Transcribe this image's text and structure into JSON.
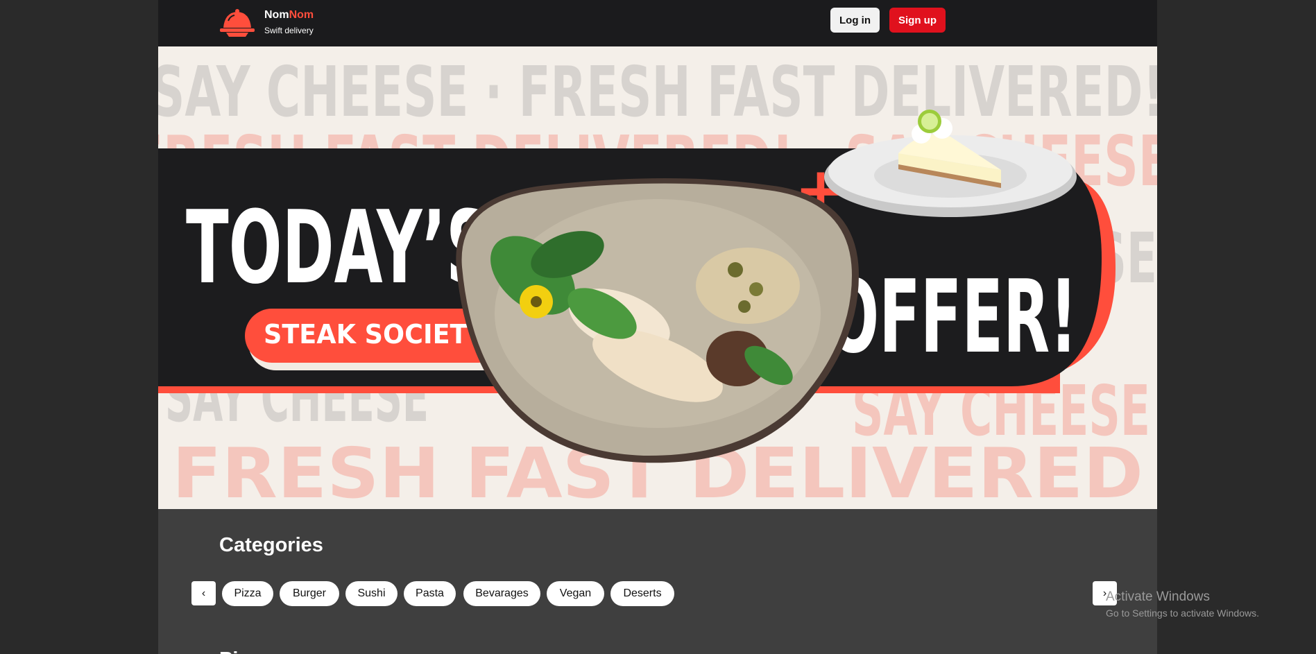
{
  "header": {
    "brand_primary": "Nom",
    "brand_accent": "Nom",
    "tagline": "Swift delivery",
    "login_label": "Log in",
    "signup_label": "Sign up"
  },
  "hero": {
    "line1": "TODAY’S",
    "line2": "OFFER!",
    "badge": "STEAK SOCIETY",
    "plus": "+",
    "bg_text_1": "SAY CHEESE · FRESH FAST DELIVERED!",
    "bg_text_2": "FRESH FAST DELIVERED! · SAY CHEESE",
    "bg_text_3": "SAY CHEESE",
    "bg_text_4": "FRESH FAST DELIVERED",
    "images": [
      "salad-steak-plate",
      "key-lime-pie-slice"
    ]
  },
  "categories": {
    "title": "Categories",
    "prev_icon": "chevron-left-icon",
    "next_icon": "chevron-right-icon",
    "items": [
      "Pizza",
      "Burger",
      "Sushi",
      "Pasta",
      "Bevarages",
      "Vegan",
      "Deserts"
    ]
  },
  "next_section": {
    "title": "Pi"
  },
  "os_watermark": {
    "line1": "Activate Windows",
    "line2": "Go to Settings to activate Windows."
  },
  "colors": {
    "accent": "#ff4e3c",
    "signup": "#e0111d",
    "header_bg": "#1b1b1d",
    "hero_band": "#1c1c1e",
    "section_bg": "#3f3f3f"
  }
}
